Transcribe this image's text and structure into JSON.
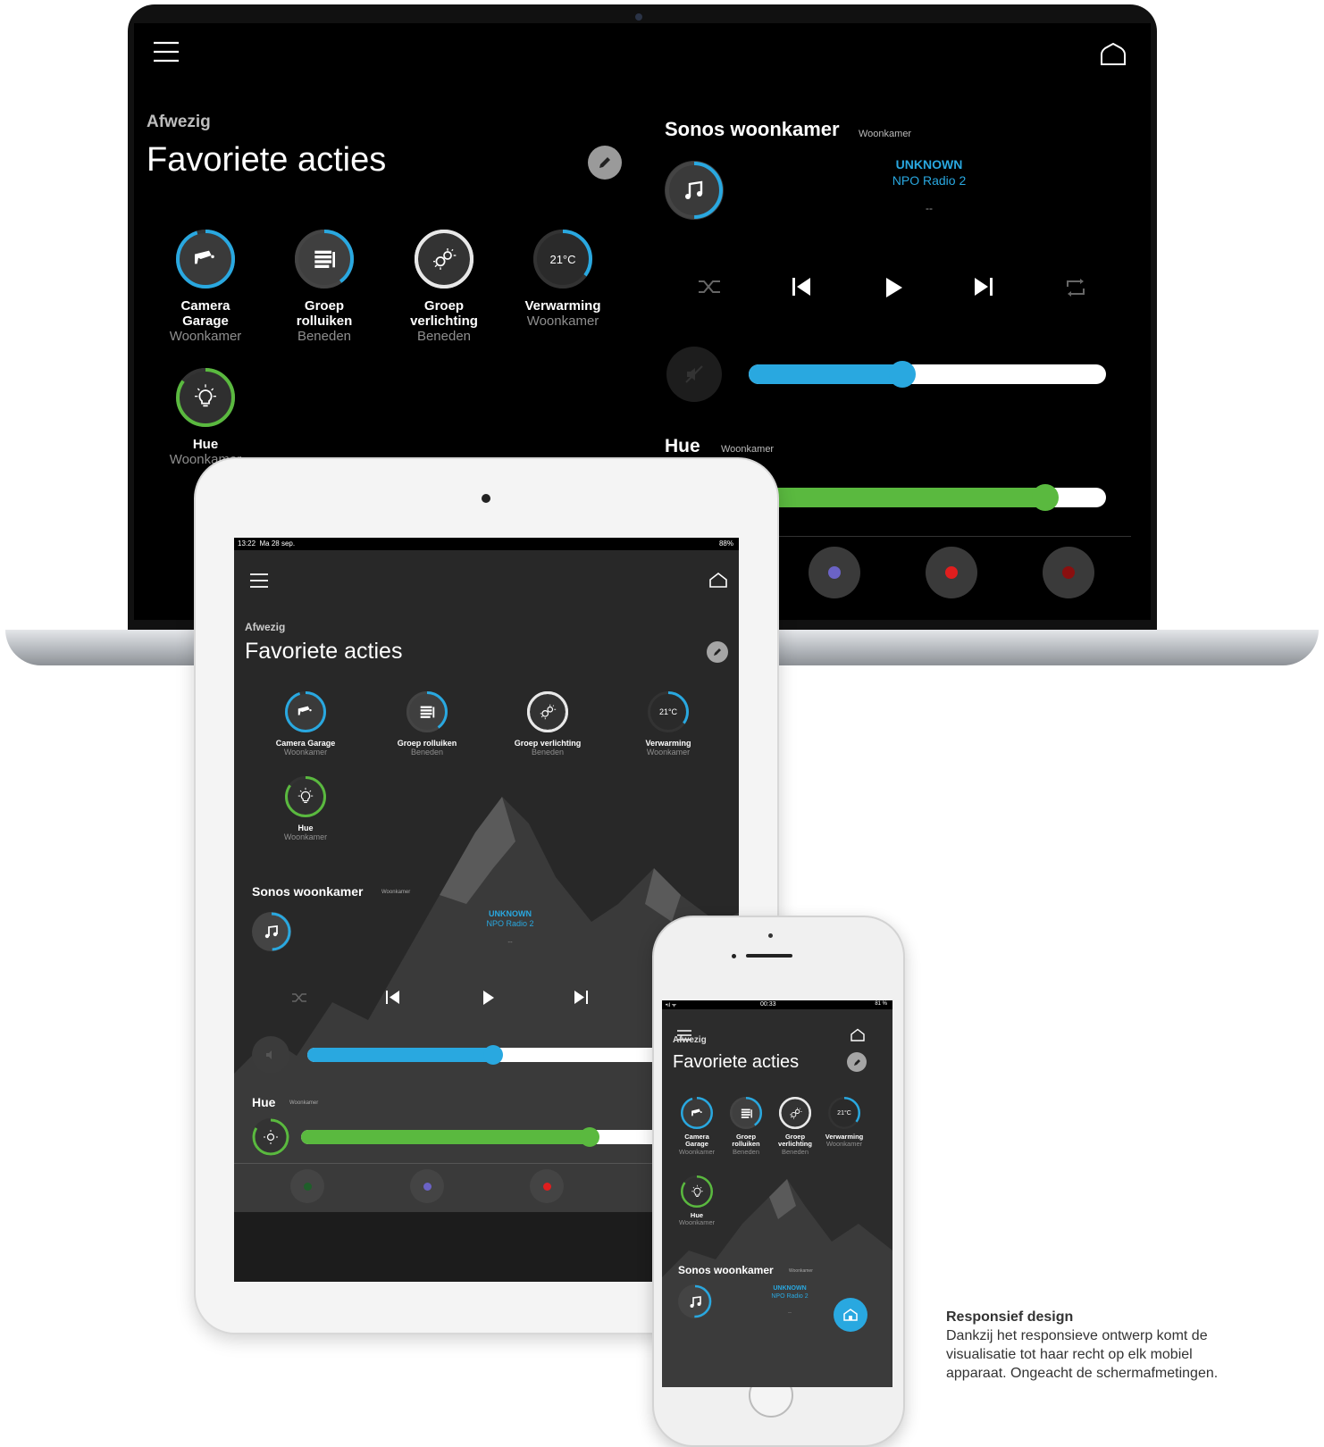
{
  "colors": {
    "accent_blue": "#29a8e0",
    "accent_green": "#5ab93f",
    "red": "#e01e1e",
    "dark_red": "#8a0f0f",
    "purple": "#6b63c6",
    "dark_green": "#1f5f2a"
  },
  "laptop": {
    "status": "Afwezig",
    "title": "Favoriete acties",
    "favorites": [
      {
        "name": "Camera\nGarage",
        "room": "Woonkamer",
        "icon": "camera-icon",
        "progress": 0.95
      },
      {
        "name": "Groep\nrolluiken",
        "room": "Beneden",
        "icon": "shutter-icon",
        "progress": 0.4
      },
      {
        "name": "Groep\nverlichting",
        "room": "Beneden",
        "icon": "light-group-icon",
        "progress": 1.0
      },
      {
        "name": "Verwarming",
        "room": "Woonkamer",
        "icon": "thermostat-icon",
        "progress": 0.35,
        "value": "21°C"
      },
      {
        "name": "Hue",
        "room": "Woonkamer",
        "icon": "bulb-icon",
        "progress": 0.85
      }
    ],
    "sonos": {
      "title": "Sonos woonkamer",
      "room": "Woonkamer",
      "track": "UNKNOWN",
      "station": "NPO Radio 2",
      "time": "--",
      "volume": 0.43
    },
    "hue": {
      "title": "Hue",
      "room": "Woonkamer",
      "level": 0.83
    }
  },
  "tablet": {
    "status_time": "13:22",
    "status_date": "Ma 28 sep.",
    "battery": "88%",
    "status": "Afwezig",
    "title": "Favoriete acties",
    "favorites": [
      {
        "name": "Camera Garage",
        "room": "Woonkamer"
      },
      {
        "name": "Groep rolluiken",
        "room": "Beneden"
      },
      {
        "name": "Groep verlichting",
        "room": "Beneden"
      },
      {
        "name": "Verwarming",
        "room": "Woonkamer",
        "value": "21°C"
      },
      {
        "name": "Hue",
        "room": "Woonkamer"
      }
    ],
    "sonos": {
      "title": "Sonos woonkamer",
      "room": "Woonkamer",
      "track": "UNKNOWN",
      "station": "NPO Radio 2",
      "time": "--",
      "volume": 0.43
    },
    "hue": {
      "title": "Hue",
      "room": "Woonkamer",
      "level": 0.66
    }
  },
  "phone": {
    "status_time": "00:33",
    "battery": "81 %",
    "status": "Afwezig",
    "title": "Favoriete acties",
    "favorites": [
      {
        "name": "Camera\nGarage",
        "room": "Woonkamer"
      },
      {
        "name": "Groep\nrolluiken",
        "room": "Beneden"
      },
      {
        "name": "Groep\nverlichting",
        "room": "Beneden"
      },
      {
        "name": "Verwarming",
        "room": "Woonkamer",
        "value": "21°C"
      },
      {
        "name": "Hue",
        "room": "Woonkamer"
      }
    ],
    "sonos": {
      "title": "Sonos woonkamer",
      "room": "Woonkamer",
      "track": "UNKNOWN",
      "station": "NPO Radio 2",
      "time": "--"
    }
  },
  "caption": {
    "title": "Responsief design",
    "body": "Dankzij het responsieve ontwerp komt de visualisatie tot haar recht op elk mobiel apparaat. Ongeacht de schermafmetingen."
  }
}
